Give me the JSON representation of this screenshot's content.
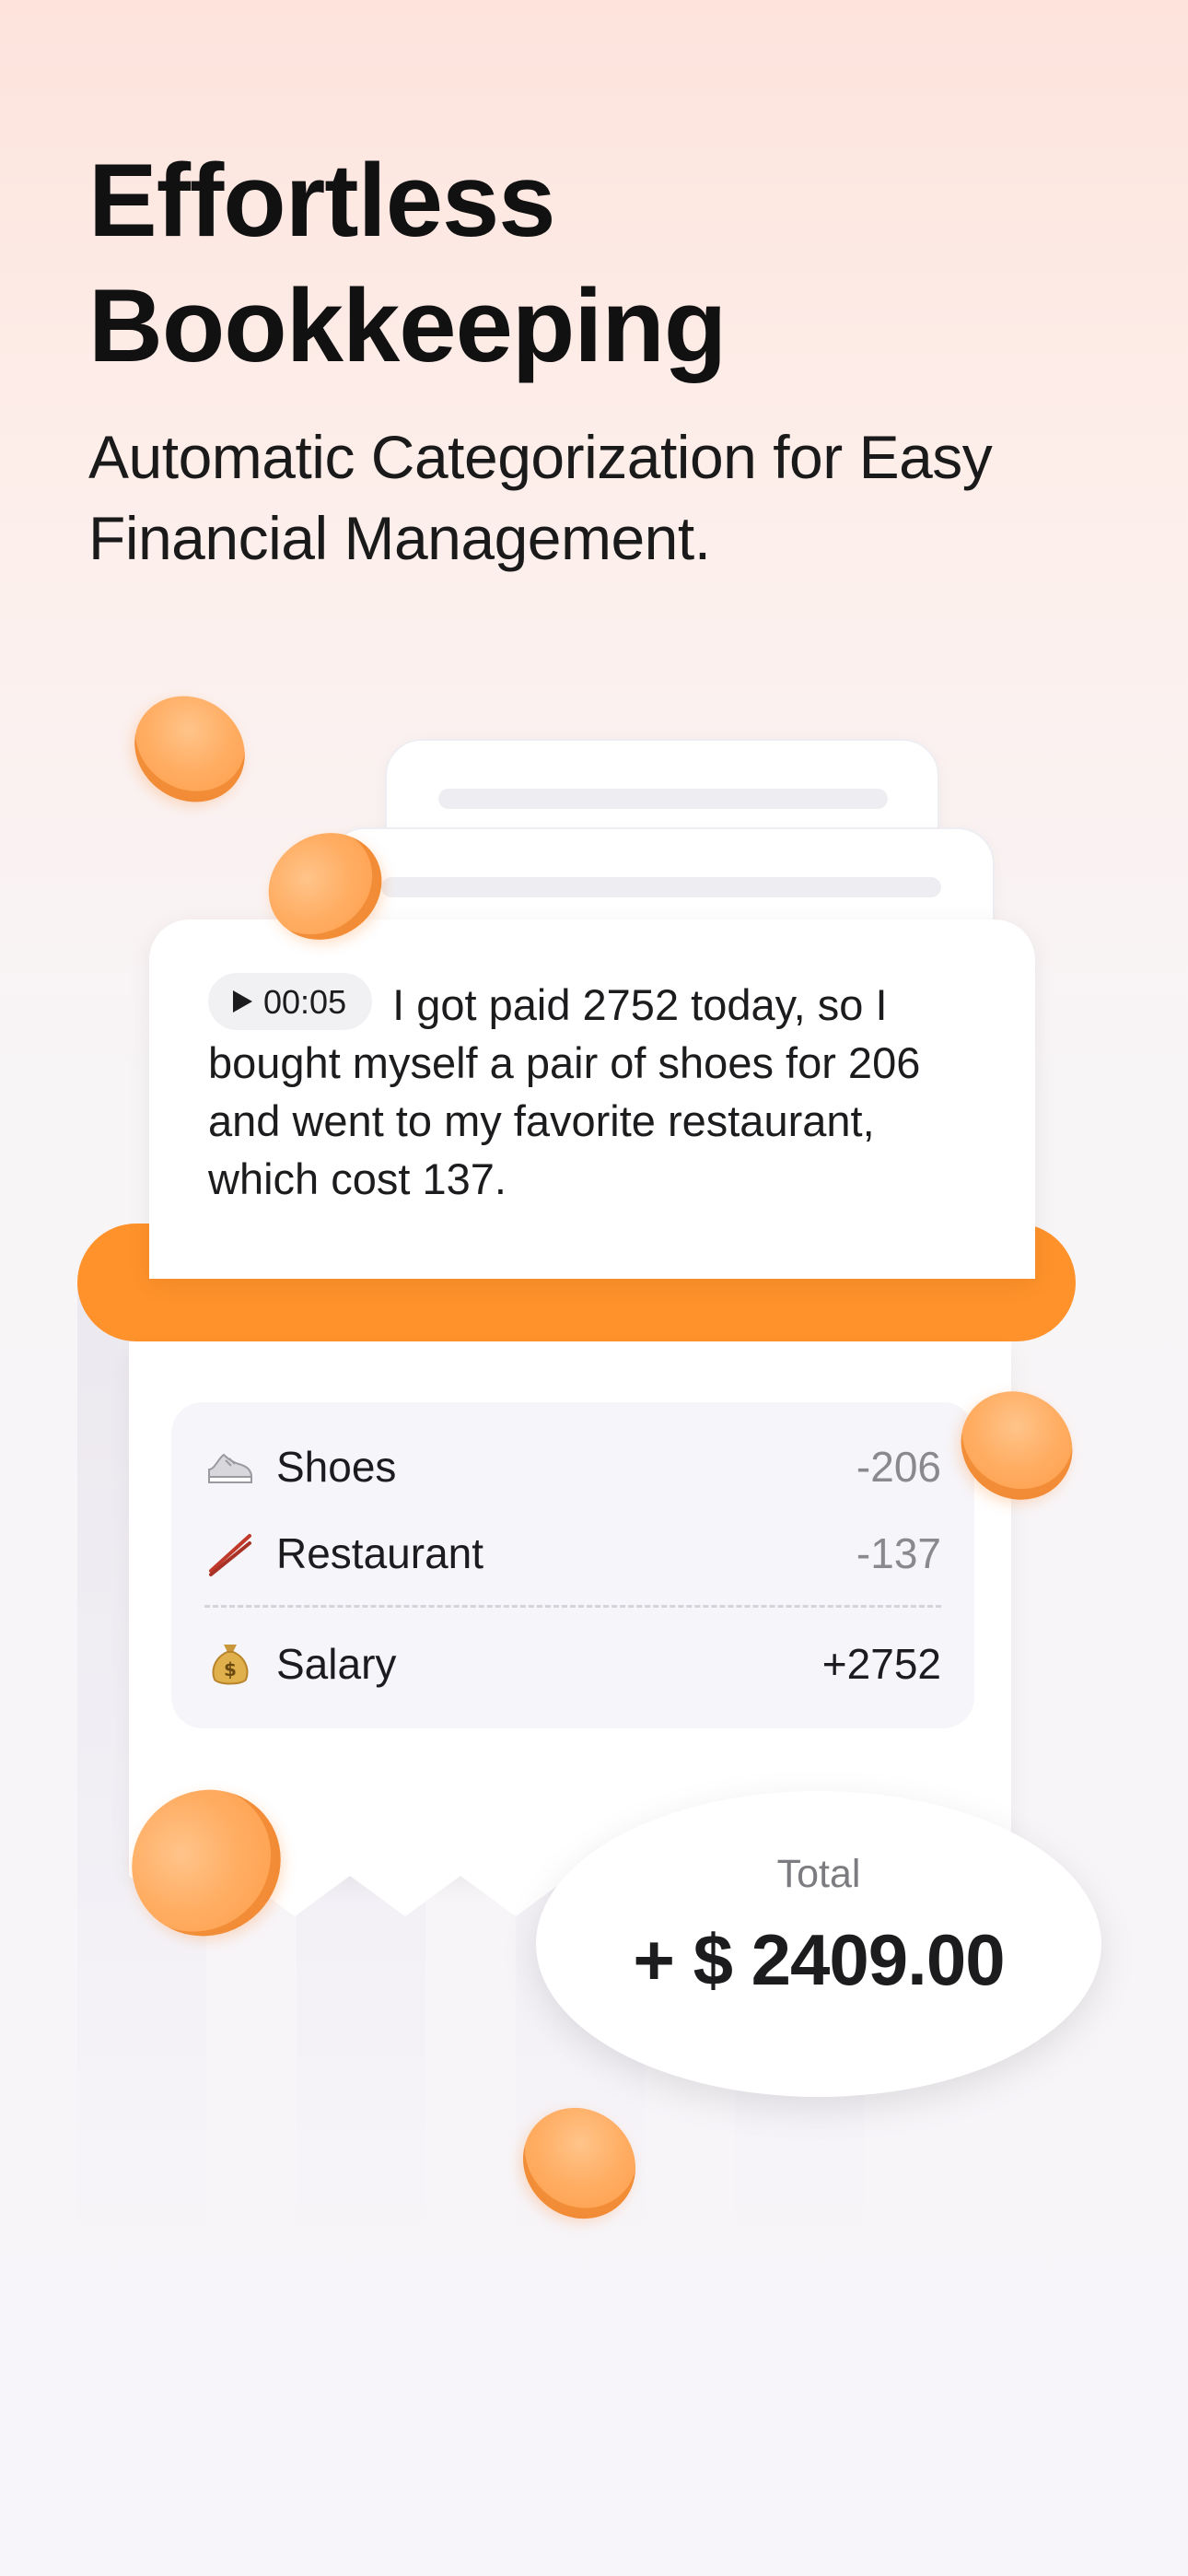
{
  "headline": {
    "line1": "Effortless",
    "line2": "Bookkeeping"
  },
  "subline": {
    "line1": "Automatic Categorization for Easy",
    "line2": "Financial Management."
  },
  "voice_note": {
    "duration": "00:05",
    "transcript": "I got paid 2752 today, so I bought myself a pair of shoes for 206 and went to my favorite restaurant, which cost 137."
  },
  "items": [
    {
      "icon": "sneaker-icon",
      "label": "Shoes",
      "amount": "-206"
    },
    {
      "icon": "chopsticks-icon",
      "label": "Restaurant",
      "amount": "-137"
    },
    {
      "icon": "money-bag-icon",
      "label": "Salary",
      "amount": "+2752"
    }
  ],
  "total": {
    "label": "Total",
    "value": "+ $ 2409.00"
  },
  "colors": {
    "accent": "#ff922a",
    "coin": "#ffad62",
    "text": "#1c1c1e",
    "muted": "#8a8a8e"
  }
}
